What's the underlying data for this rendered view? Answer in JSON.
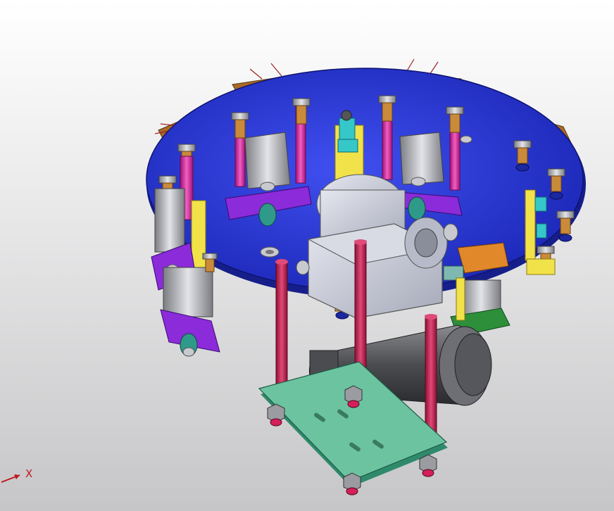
{
  "viewport": {
    "background_top": "#ffffff",
    "background_bottom": "#c6c6c8"
  },
  "model": {
    "base_plate_color": "#2a39d8",
    "lift_rod_color": "#d51f8a",
    "guide_rod_color": "#c8144a",
    "bracket_color": "#8b2bd9",
    "clamp_color": "#f2e24a",
    "mount_plate_color": "#6cc3a0",
    "motor_color": "#5d5f63",
    "gearbox_color": "#c5c8d6",
    "pad_color": "#a86a25",
    "green_bracket_color": "#2e8f3a",
    "orange_bracket_color": "#e0882a"
  },
  "triad": {
    "x_label": "X",
    "axis_color": "#c0161c"
  }
}
